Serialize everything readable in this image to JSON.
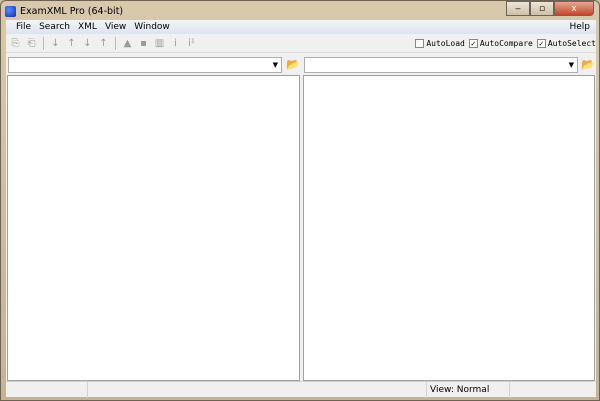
{
  "window": {
    "title": "ExamXML Pro (64-bit)",
    "minimize": "‒",
    "maximize": "▫",
    "close": "x"
  },
  "menu": {
    "items": [
      "File",
      "Search",
      "XML",
      "View",
      "Window"
    ],
    "help": "Help"
  },
  "toolbar": {
    "options": [
      {
        "label": "AutoLoad",
        "checked": false
      },
      {
        "label": "AutoCompare",
        "checked": true
      },
      {
        "label": "AutoSelect",
        "checked": true
      }
    ]
  },
  "combos": {
    "left": {
      "value": ""
    },
    "right": {
      "value": ""
    }
  },
  "status": {
    "cell1": "",
    "cell2": "",
    "view": "View: Normal",
    "cell4": ""
  }
}
